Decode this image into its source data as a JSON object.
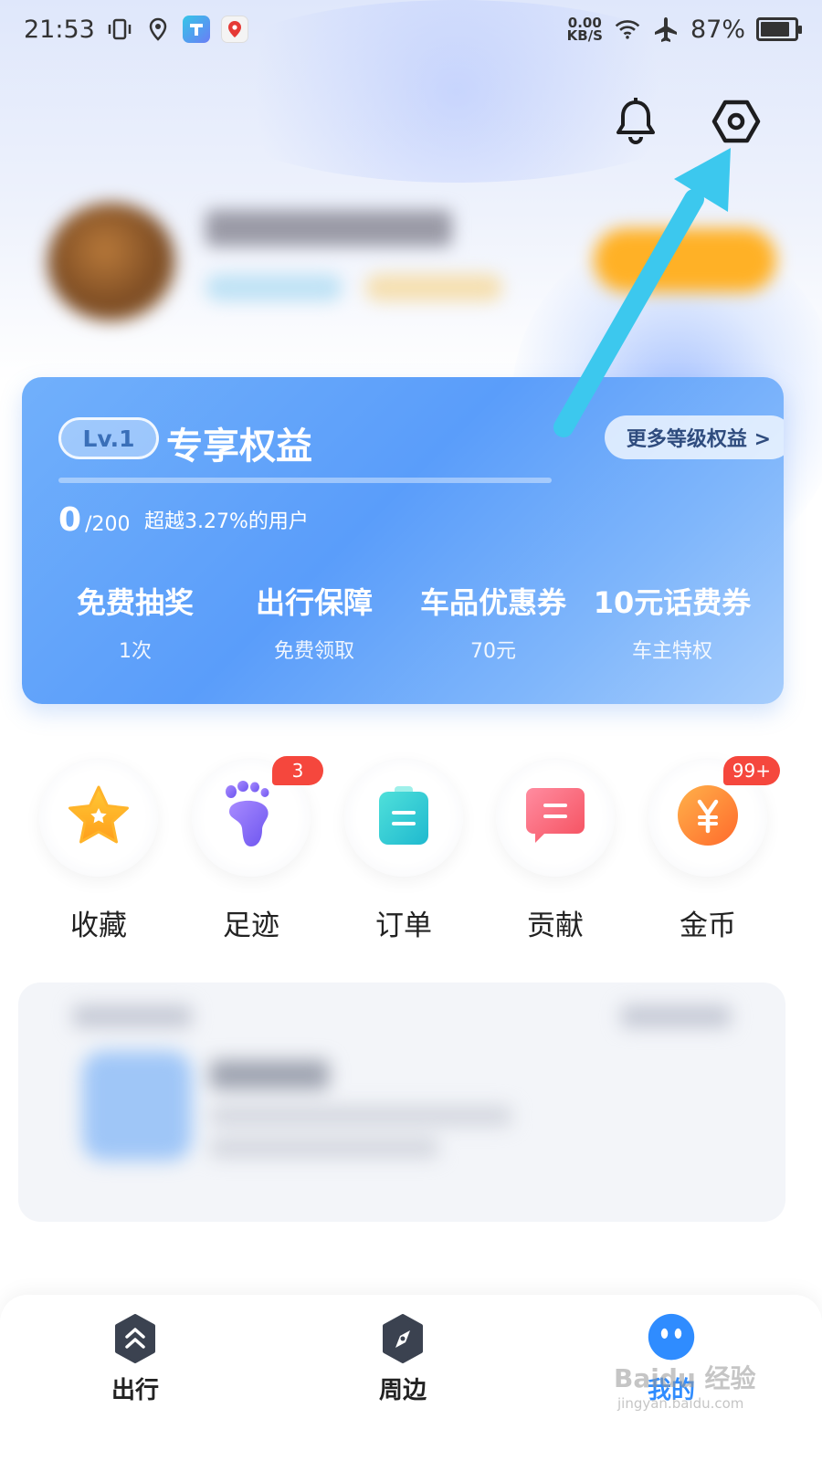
{
  "status_bar": {
    "time": "21:53",
    "net_speed_value": "0.00",
    "net_speed_unit": "KB/S",
    "battery": "87%",
    "battery_level": 0.87
  },
  "header": {
    "notification_icon": "bell-icon",
    "settings_icon": "settings-hexagon-icon"
  },
  "level_card": {
    "level_badge": "Lv.1",
    "title": "专享权益",
    "more_rights": "更多等级权益 >",
    "points_current": "0",
    "points_total": "/200",
    "points_progress": 0,
    "rank_text": "超越3.27%的用户",
    "benefits": [
      {
        "title": "免费抽奖",
        "sub": "1次"
      },
      {
        "title": "出行保障",
        "sub": "免费领取"
      },
      {
        "title": "车品优惠券",
        "sub": "70元"
      },
      {
        "title": "10元话费券",
        "sub": "车主特权"
      }
    ]
  },
  "quick_actions": [
    {
      "label": "收藏",
      "icon": "star-icon",
      "badge": ""
    },
    {
      "label": "足迹",
      "icon": "footprint-icon",
      "badge": "3"
    },
    {
      "label": "订单",
      "icon": "order-icon",
      "badge": ""
    },
    {
      "label": "贡献",
      "icon": "contribution-icon",
      "badge": ""
    },
    {
      "label": "金币",
      "icon": "coin-icon",
      "badge": "99+"
    }
  ],
  "bottom_nav": [
    {
      "label": "出行",
      "icon": "travel-icon"
    },
    {
      "label": "周边",
      "icon": "compass-icon"
    },
    {
      "label": "我的",
      "icon": "mine-icon"
    }
  ],
  "watermark": {
    "text": "Baidu 经验",
    "sub": "jingyan.baidu.com"
  },
  "colors": {
    "accent_blue": "#5a9dfa",
    "badge_red": "#f5473d",
    "arrow_cyan": "#3cc8ee"
  }
}
